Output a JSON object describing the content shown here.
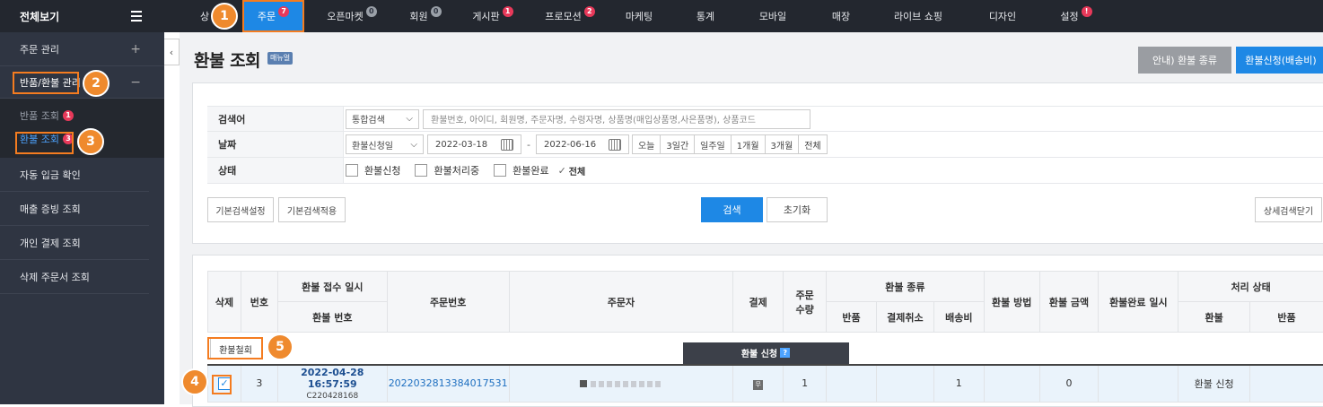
{
  "sidebar": {
    "header": "전체보기",
    "order_mgmt": "주문 관리",
    "return_refund_mgmt": "반품/환불 관리",
    "sub_items": [
      {
        "label": "반품 조회",
        "badge": "1"
      },
      {
        "label": "환불 조회",
        "badge": "3"
      }
    ],
    "links": [
      "자동 입금 확인",
      "매출 증빙 조회",
      "개인 결제 조회",
      "삭제 주문서 조회"
    ]
  },
  "topnav": {
    "items": [
      {
        "label": "상",
        "badge": ""
      },
      {
        "label": "주문",
        "badge": "7"
      },
      {
        "label": "오픈마켓",
        "badge": "0"
      },
      {
        "label": "회원",
        "badge": "0"
      },
      {
        "label": "게시판",
        "badge": "1"
      },
      {
        "label": "프로모션",
        "badge": "2"
      },
      {
        "label": "마케팅",
        "badge": ""
      },
      {
        "label": "통계",
        "badge": ""
      },
      {
        "label": "모바일",
        "badge": ""
      },
      {
        "label": "매장",
        "badge": ""
      },
      {
        "label": "라이브 쇼핑",
        "badge": ""
      },
      {
        "label": "디자인",
        "badge": ""
      },
      {
        "label": "설정",
        "badge": "!"
      }
    ]
  },
  "page": {
    "title": "환불 조회",
    "manual_tag": "매뉴얼",
    "btn_refund_types": "안내) 환불 종류",
    "btn_refund_apply": "환불신청(배송비)"
  },
  "search": {
    "keyword_label": "검색어",
    "keyword_select": "통합검색",
    "keyword_placeholder": "환불번호, 아이디, 회원명, 주문자명, 수령자명, 상품명(매입상품명,사은품명), 상품코드",
    "date_label": "날짜",
    "date_select": "환불신청일",
    "date_from": "2022-03-18",
    "date_sep": "-",
    "date_to": "2022-06-16",
    "quick_ranges": [
      "오늘",
      "3일간",
      "일주일",
      "1개월",
      "3개월",
      "전체"
    ],
    "status_label": "상태",
    "statuses": [
      "환불신청",
      "환불처리중",
      "환불완료"
    ],
    "status_all": "전체",
    "btn_default_setting": "기본검색설정",
    "btn_default_apply": "기본검색적용",
    "btn_search": "검색",
    "btn_reset": "초기화",
    "btn_close_detail": "상세검색닫기"
  },
  "table": {
    "headers": {
      "delete": "삭제",
      "no": "번호",
      "received_at": "환불 접수 일시",
      "refund_no": "환불 번호",
      "order_no": "주문번호",
      "orderer": "주문자",
      "payment": "결제",
      "order_qty": "주문 수량",
      "refund_type": "환불 종류",
      "rt_return": "반품",
      "rt_cancel": "결제취소",
      "rt_shipping": "배송비",
      "refund_method": "환불 방법",
      "refund_amount": "환불 금액",
      "refund_done_at": "환불완료 일시",
      "proc_status": "처리 상태",
      "ps_refund": "환불",
      "ps_return": "반품"
    },
    "withdraw_button": "환불철회",
    "group_label": "환불 신청",
    "group_help": "?",
    "rows": [
      {
        "no": "3",
        "received_at": "2022-04-28 16:57:59",
        "refund_no": "C220428168",
        "order_no": "20220328133840175​31",
        "payment_icon": "무",
        "qty": "1",
        "rt_return": "",
        "rt_cancel": "",
        "rt_shipping": "1",
        "method": "",
        "amount": "0",
        "done_at": "",
        "ps_refund": "환불 신청",
        "ps_return": ""
      }
    ]
  },
  "callouts": [
    "1",
    "2",
    "3",
    "4",
    "5"
  ],
  "colors": {
    "accent": "#1e88e5",
    "highlight": "#f47c20",
    "badge": "#e8395a",
    "sidebar": "#2f3542"
  }
}
